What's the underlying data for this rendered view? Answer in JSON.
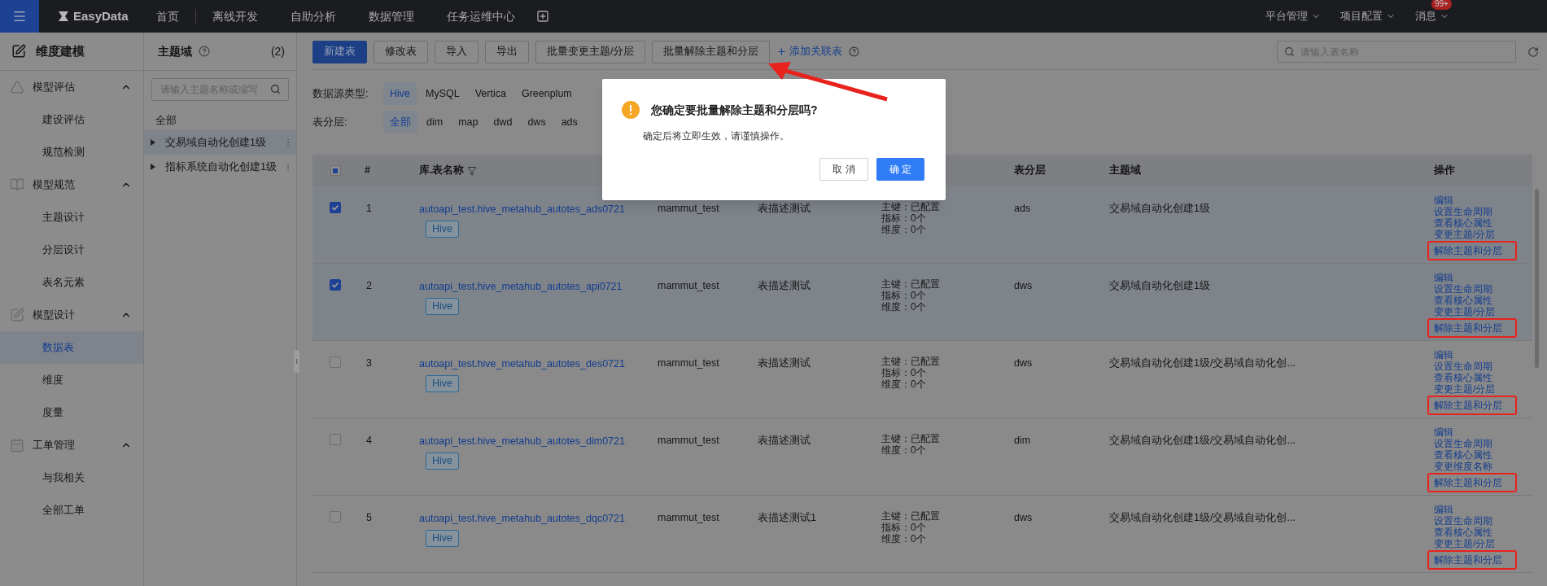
{
  "top_bar": {
    "logo": "EasyData",
    "nav": [
      "首页",
      "离线开发",
      "自助分析",
      "数据管理",
      "任务运维中心"
    ],
    "right_menu": [
      {
        "label": "平台管理"
      },
      {
        "label": "项目配置"
      },
      {
        "label": "消息",
        "badge": "99+"
      }
    ]
  },
  "sidebar": {
    "title": "维度建模",
    "groups": [
      {
        "label": "模型评估",
        "expanded": true,
        "items": [
          {
            "label": "建设评估",
            "selected": false
          },
          {
            "label": "规范检测",
            "selected": false
          }
        ]
      },
      {
        "label": "模型规范",
        "expanded": true,
        "items": [
          {
            "label": "主题设计",
            "selected": false
          },
          {
            "label": "分层设计",
            "selected": false
          },
          {
            "label": "表名元素",
            "selected": false
          }
        ]
      },
      {
        "label": "模型设计",
        "expanded": true,
        "items": [
          {
            "label": "数据表",
            "selected": true
          },
          {
            "label": "维度",
            "selected": false
          },
          {
            "label": "度量",
            "selected": false
          }
        ]
      },
      {
        "label": "工单管理",
        "expanded": true,
        "items": [
          {
            "label": "与我相关",
            "selected": false
          },
          {
            "label": "全部工单",
            "selected": false
          }
        ]
      }
    ]
  },
  "topic_panel": {
    "title": "主题域",
    "count": "(2)",
    "search": {
      "placeholder": "请输入主题名称或缩写"
    },
    "all_label": "全部",
    "items": [
      {
        "label": "交易域自动化创建1级",
        "selected": true
      },
      {
        "label": "指标系统自动化创建1级",
        "selected": false
      }
    ]
  },
  "toolbar": {
    "buttons": [
      {
        "label": "新建表",
        "kind": "primary"
      },
      {
        "label": "修改表",
        "kind": "default"
      },
      {
        "label": "导入",
        "kind": "default"
      },
      {
        "label": "导出",
        "kind": "default"
      },
      {
        "label": "批量变更主题/分层",
        "kind": "default"
      },
      {
        "label": "批量解除主题和分层",
        "kind": "default"
      }
    ],
    "link": "添加关联表",
    "search": {
      "placeholder": "请输入表名称"
    }
  },
  "filters": [
    {
      "label": "数据源类型:",
      "options": [
        {
          "label": "Hive",
          "selected": true
        },
        {
          "label": "MySQL",
          "selected": false
        },
        {
          "label": "Vertica",
          "selected": false
        },
        {
          "label": "Greenplum",
          "selected": false
        }
      ]
    },
    {
      "label": "表分层:",
      "options": [
        {
          "label": "全部",
          "selected": true
        },
        {
          "label": "dim",
          "selected": false
        },
        {
          "label": "map",
          "selected": false
        },
        {
          "label": "dwd",
          "selected": false
        },
        {
          "label": "dws",
          "selected": false
        },
        {
          "label": "ads",
          "selected": false
        }
      ]
    }
  ],
  "table": {
    "header_checkbox": {
      "indeterminate": true
    },
    "columns": [
      "#",
      "库.表名称",
      "表分层",
      "主题域",
      "操作"
    ],
    "rows": [
      {
        "checked": true,
        "index": "1",
        "name": "autoapi_test.hive_metahub_autotes_ads0721",
        "tag": "Hive",
        "owner": "mammut_test",
        "description": "表描述测试",
        "info": [
          "主键：已配置",
          "指标：0个",
          "维度：0个"
        ],
        "layer": "ads",
        "domain": "交易域自动化创建1级",
        "actions": [
          {
            "label": "编辑",
            "highlighted": false
          },
          {
            "label": "设置生命周期",
            "highlighted": false
          },
          {
            "label": "查看核心属性",
            "highlighted": false
          },
          {
            "label": "变更主题/分层",
            "highlighted": false
          },
          {
            "label": "解除主题和分层",
            "highlighted": true
          }
        ]
      },
      {
        "checked": true,
        "index": "2",
        "name": "autoapi_test.hive_metahub_autotes_api0721",
        "tag": "Hive",
        "owner": "mammut_test",
        "description": "表描述测试",
        "info": [
          "主键：已配置",
          "指标：0个",
          "维度：0个"
        ],
        "layer": "dws",
        "domain": "交易域自动化创建1级",
        "actions": [
          {
            "label": "编辑",
            "highlighted": false
          },
          {
            "label": "设置生命周期",
            "highlighted": false
          },
          {
            "label": "查看核心属性",
            "highlighted": false
          },
          {
            "label": "变更主题/分层",
            "highlighted": false
          },
          {
            "label": "解除主题和分层",
            "highlighted": true
          }
        ]
      },
      {
        "checked": false,
        "index": "3",
        "name": "autoapi_test.hive_metahub_autotes_des0721",
        "tag": "Hive",
        "owner": "mammut_test",
        "description": "表描述测试",
        "info": [
          "主键：已配置",
          "指标：0个",
          "维度：0个"
        ],
        "layer": "dws",
        "domain": "交易域自动化创建1级/交易域自动化创...",
        "actions": [
          {
            "label": "编辑",
            "highlighted": false
          },
          {
            "label": "设置生命周期",
            "highlighted": false
          },
          {
            "label": "查看核心属性",
            "highlighted": false
          },
          {
            "label": "变更主题/分层",
            "highlighted": false
          },
          {
            "label": "解除主题和分层",
            "highlighted": true
          }
        ]
      },
      {
        "checked": false,
        "index": "4",
        "name": "autoapi_test.hive_metahub_autotes_dim0721",
        "tag": "Hive",
        "owner": "mammut_test",
        "description": "表描述测试",
        "info": [
          "主键：已配置",
          "维度：0个"
        ],
        "layer": "dim",
        "domain": "交易域自动化创建1级/交易域自动化创...",
        "actions": [
          {
            "label": "编辑",
            "highlighted": false
          },
          {
            "label": "设置生命周期",
            "highlighted": false
          },
          {
            "label": "查看核心属性",
            "highlighted": false
          },
          {
            "label": "变更维度名称",
            "highlighted": false
          },
          {
            "label": "解除主题和分层",
            "highlighted": true
          }
        ]
      },
      {
        "checked": false,
        "index": "5",
        "name": "autoapi_test.hive_metahub_autotes_dqc0721",
        "tag": "Hive",
        "owner": "mammut_test",
        "description": "表描述测试1",
        "info": [
          "主键：已配置",
          "指标：0个",
          "维度：0个"
        ],
        "layer": "dws",
        "domain": "交易域自动化创建1级/交易域自动化创...",
        "actions": [
          {
            "label": "编辑",
            "highlighted": false
          },
          {
            "label": "设置生命周期",
            "highlighted": false
          },
          {
            "label": "查看核心属性",
            "highlighted": false
          },
          {
            "label": "变更主题/分层",
            "highlighted": false
          },
          {
            "label": "解除主题和分层",
            "highlighted": true
          }
        ]
      }
    ]
  },
  "dialog": {
    "title": "您确定要批量解除主题和分层吗?",
    "message": "确定后将立即生效，请谨慎操作。",
    "cancel": "取 消",
    "confirm": "确 定"
  }
}
